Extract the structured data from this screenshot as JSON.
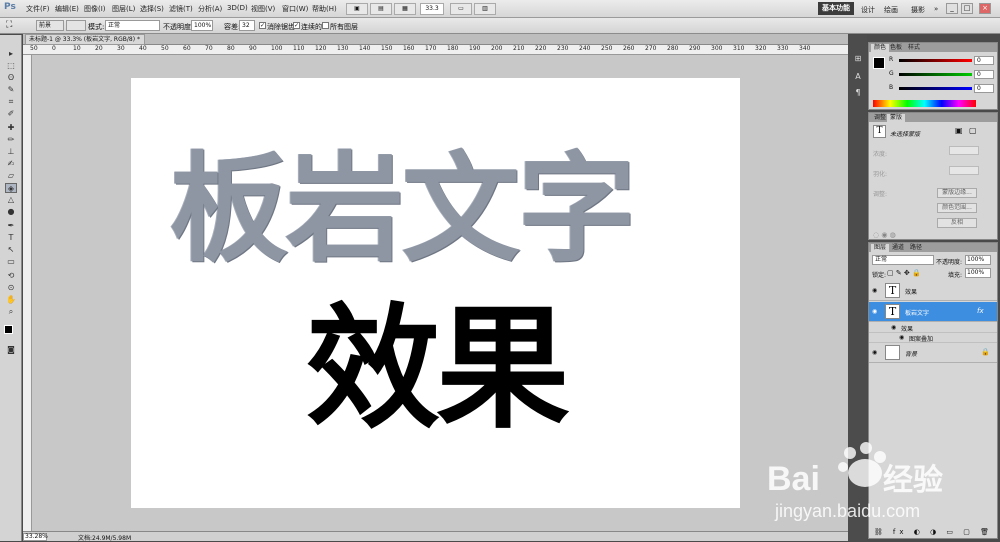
{
  "menubar": {
    "logo": "Ps",
    "items": [
      "文件(F)",
      "编辑(E)",
      "图像(I)",
      "图层(L)",
      "选择(S)",
      "滤镜(T)",
      "分析(A)",
      "3D(D)",
      "视图(V)",
      "窗口(W)",
      "帮助(H)"
    ],
    "zoom": "33.3",
    "workspaces": [
      "基本功能",
      "设计",
      "绘画",
      "摄影"
    ],
    "more": "»",
    "window_buttons": [
      "_",
      "□",
      "×"
    ]
  },
  "options": {
    "fg_label": "前景",
    "mode_label": "模式:",
    "mode_value": "正常",
    "opacity_label": "不透明度:",
    "opacity_value": "100%",
    "tolerance_label": "容差:",
    "tolerance_value": "32",
    "antialias_label": "消除锯齿",
    "contiguous_label": "连续的",
    "all_layers_label": "所有图层"
  },
  "document": {
    "tab_label": "未标题-1 @ 33.3% (板岩文字, RGB/8) * ×",
    "ruler_ticks": [
      "50",
      "0",
      "10",
      "20",
      "30",
      "40",
      "50",
      "60",
      "70",
      "80",
      "90",
      "100",
      "110",
      "120",
      "130",
      "140",
      "150",
      "160",
      "170",
      "180",
      "190",
      "200",
      "210",
      "220",
      "230",
      "240",
      "250",
      "260",
      "270",
      "280",
      "290",
      "300",
      "310",
      "320",
      "330",
      "340"
    ],
    "canvas_text_1": "板岩文字",
    "canvas_text_2": "效果"
  },
  "statusbar": {
    "zoom": "33.28%",
    "doc_info": "文档:24.9M/5.98M"
  },
  "color_panel": {
    "tabs": [
      "颜色",
      "色板",
      "样式"
    ],
    "channels": [
      {
        "label": "R",
        "value": "0"
      },
      {
        "label": "G",
        "value": "0"
      },
      {
        "label": "B",
        "value": "0"
      }
    ]
  },
  "adjust_panel": {
    "tabs": [
      "调整",
      "蒙版"
    ],
    "title": "未选择蒙版",
    "rows": [
      "浓度:",
      "羽化:",
      "调整:"
    ],
    "buttons": [
      "蒙版边缘...",
      "颜色范围...",
      "反相"
    ]
  },
  "layers_panel": {
    "tabs": [
      "图层",
      "通道",
      "路径"
    ],
    "blend_mode": "正常",
    "opacity_label": "不透明度:",
    "opacity_value": "100%",
    "lock_label": "锁定:",
    "fill_label": "填充:",
    "fill_value": "100%",
    "layers": [
      {
        "name": "效果",
        "thumb": "T"
      },
      {
        "name": "板岩文字",
        "thumb": "T",
        "fx": "fx"
      },
      {
        "name": "背景",
        "thumb": ""
      }
    ],
    "effects_label": "效果",
    "pattern_overlay_label": "图案叠加"
  },
  "watermark": {
    "brand": "Bai",
    "brand_suffix": "经验",
    "url": "jingyan.baidu.com"
  },
  "colors": {
    "selected_layer": "#3d8ee0",
    "stone": "#8e96a4"
  }
}
